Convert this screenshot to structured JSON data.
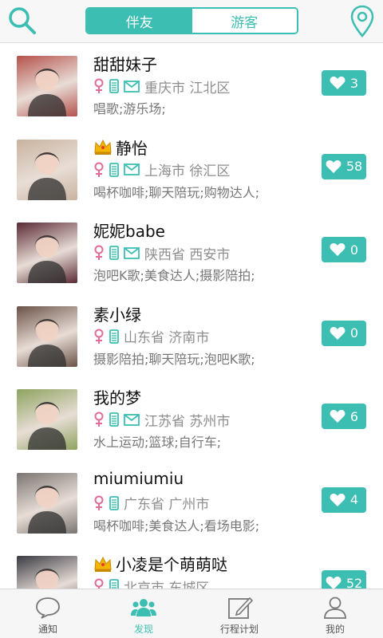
{
  "header": {
    "tabs": [
      {
        "label": "伴友",
        "active": true
      },
      {
        "label": "游客",
        "active": false
      }
    ],
    "search_icon": "search-icon",
    "location_icon": "location-pin-icon"
  },
  "list": [
    {
      "name": "甜甜妹子",
      "crown": false,
      "gender": "female",
      "phone": true,
      "mail": true,
      "location": "重庆市 江北区",
      "tags": "唱歌;游乐场;",
      "likes": "3",
      "avatar_bg": "#b5524c"
    },
    {
      "name": "静怡",
      "crown": true,
      "gender": "female",
      "phone": true,
      "mail": true,
      "location": "上海市 徐汇区",
      "tags": "喝杯咖啡;聊天陪玩;购物达人;",
      "likes": "58",
      "avatar_bg": "#c9b39f"
    },
    {
      "name": "妮妮babe",
      "crown": false,
      "gender": "female",
      "phone": true,
      "mail": true,
      "location": "陕西省 西安市",
      "tags": "泡吧K歌;美食达人;摄影陪拍;",
      "likes": "0",
      "avatar_bg": "#5a2a35"
    },
    {
      "name": "素小绿",
      "crown": false,
      "gender": "female",
      "phone": true,
      "mail": false,
      "location": "山东省 济南市",
      "tags": "摄影陪拍;聊天陪玩;泡吧K歌;",
      "likes": "0",
      "avatar_bg": "#6b5248"
    },
    {
      "name": "我的梦",
      "crown": false,
      "gender": "female",
      "phone": true,
      "mail": true,
      "location": "江苏省 苏州市",
      "tags": "水上运动;篮球;自行车;",
      "likes": "6",
      "avatar_bg": "#8da35e"
    },
    {
      "name": "miumiumiu",
      "crown": false,
      "gender": "female",
      "phone": true,
      "mail": false,
      "location": "广东省 广州市",
      "tags": "喝杯咖啡;美食达人;看场电影;",
      "likes": "4",
      "avatar_bg": "#7a7572"
    },
    {
      "name": "小凌是个萌萌哒",
      "crown": true,
      "gender": "female",
      "phone": true,
      "mail": false,
      "location": "北京市 东城区",
      "tags": "",
      "likes": "52",
      "avatar_bg": "#3a3a44"
    }
  ],
  "nav": [
    {
      "label": "通知",
      "icon": "chat-bubble-icon",
      "active": false
    },
    {
      "label": "发现",
      "icon": "people-icon",
      "active": true
    },
    {
      "label": "行程计划",
      "icon": "edit-note-icon",
      "active": false
    },
    {
      "label": "我的",
      "icon": "user-icon",
      "active": false
    }
  ],
  "colors": {
    "accent": "#3cbfb2",
    "female": "#e36b9a",
    "text": "#111111",
    "muted": "#8e8e8e"
  }
}
